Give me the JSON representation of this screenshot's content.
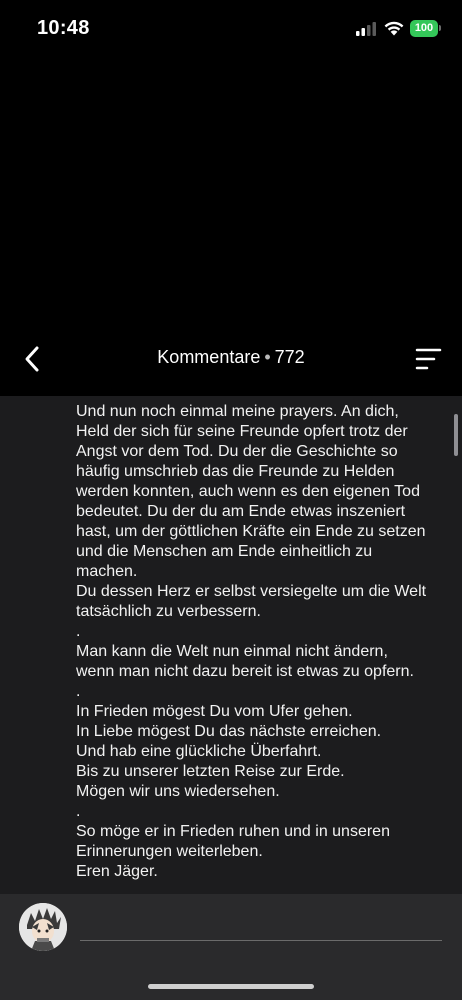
{
  "status_bar": {
    "time": "10:48",
    "battery": "100"
  },
  "header": {
    "title": "Kommentare",
    "separator": "•",
    "count": "772",
    "back_icon": "chevron-left-icon",
    "sort_icon": "sort-lines-icon"
  },
  "comment": {
    "text": ".\nUnd nun noch einmal meine prayers. An dich,\nHeld der sich für seine Freunde opfert trotz der\nAngst vor dem Tod. Du der die Geschichte so\nhäufig umschrieb das die Freunde zu Helden\nwerden konnten, auch wenn es den eigenen Tod\nbedeutet. Du der du am Ende etwas inszeniert\nhast, um der göttlichen Kräfte ein Ende zu setzen\nund die Menschen am Ende einheitlich zu\nmachen.\nDu dessen Herz er selbst versiegelte um die Welt\ntatsächlich zu verbessern.\n.\nMan kann die Welt nun einmal nicht ändern,\nwenn man nicht dazu bereit ist etwas zu opfern.\n.\nIn Frieden mögest Du vom Ufer gehen.\nIn Liebe mögest Du das nächste erreichen.\nUnd hab eine glückliche Überfahrt.\nBis zu unserer letzten Reise zur Erde.\nMögen wir uns wiedersehen.\n.\nSo möge er in Frieden ruhen und in unseren\nErinnerungen weiterleben.\nEren Jäger."
  },
  "composer": {
    "placeholder": "",
    "avatar_icon": "user-avatar"
  },
  "colors": {
    "battery": "#34c759",
    "comment_bg": "#1c1c1e",
    "composer_bg": "#2a2a2c"
  }
}
